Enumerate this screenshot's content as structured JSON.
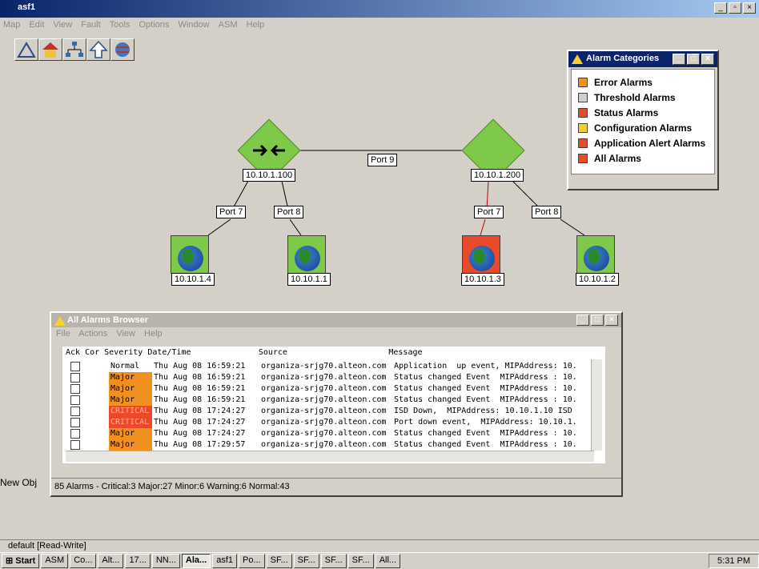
{
  "window": {
    "title": "asf1",
    "menu": [
      "Map",
      "Edit",
      "View",
      "Fault",
      "Tools",
      "Options",
      "Window",
      "ASM",
      "Help"
    ]
  },
  "map": {
    "switches": [
      {
        "ip": "10.10.1.100"
      },
      {
        "ip": "10.10.1.200"
      }
    ],
    "ports": {
      "trunk": "Port 9",
      "a7": "Port 7",
      "a8": "Port 8",
      "b7": "Port 7",
      "b8": "Port 8"
    },
    "hosts": [
      {
        "ip": "10.10.1.4",
        "status": "ok"
      },
      {
        "ip": "10.10.1.1",
        "status": "ok"
      },
      {
        "ip": "10.10.1.3",
        "status": "critical"
      },
      {
        "ip": "10.10.1.2",
        "status": "ok"
      }
    ]
  },
  "alarm_categories": {
    "title": "Alarm Categories",
    "items": [
      {
        "label": "Error Alarms",
        "color": "#f09020"
      },
      {
        "label": "Threshold Alarms",
        "color": "#d0d0d0"
      },
      {
        "label": "Status Alarms",
        "color": "#e84a2a"
      },
      {
        "label": "Configuration Alarms",
        "color": "#f8d030"
      },
      {
        "label": "Application Alert Alarms",
        "color": "#e84a2a"
      },
      {
        "label": "All Alarms",
        "color": "#e84a2a"
      }
    ]
  },
  "browser": {
    "title": "All Alarms Browser",
    "menu": [
      "File",
      "Actions",
      "View",
      "Help"
    ],
    "header": "Ack Cor Severity Date/Time              Source                     Message",
    "rows": [
      {
        "sev": "Normal",
        "cls": "normal",
        "dt": "Thu Aug 08 16:59:21",
        "src": "organiza-srjg70.alteon.com",
        "msg": "Application  up event, MIPAddress: 10."
      },
      {
        "sev": "Major",
        "cls": "major",
        "dt": "Thu Aug 08 16:59:21",
        "src": "organiza-srjg70.alteon.com",
        "msg": "Status changed Event  MIPAddress : 10."
      },
      {
        "sev": "Major",
        "cls": "major",
        "dt": "Thu Aug 08 16:59:21",
        "src": "organiza-srjg70.alteon.com",
        "msg": "Status changed Event  MIPAddress : 10."
      },
      {
        "sev": "Major",
        "cls": "major",
        "dt": "Thu Aug 08 16:59:21",
        "src": "organiza-srjg70.alteon.com",
        "msg": "Status changed Event  MIPAddress : 10."
      },
      {
        "sev": "CRITICAL",
        "cls": "critical",
        "dt": "Thu Aug 08 17:24:27",
        "src": "organiza-srjg70.alteon.com",
        "msg": "ISD Down,  MIPAddress: 10.10.1.10 ISD"
      },
      {
        "sev": "CRITICAL",
        "cls": "critical",
        "dt": "Thu Aug 08 17:24:27",
        "src": "organiza-srjg70.alteon.com",
        "msg": "Port down event,  MIPAddress: 10.10.1."
      },
      {
        "sev": "Major",
        "cls": "major",
        "dt": "Thu Aug 08 17:24:27",
        "src": "organiza-srjg70.alteon.com",
        "msg": "Status changed Event  MIPAddress : 10."
      },
      {
        "sev": "Major",
        "cls": "major",
        "dt": "Thu Aug 08 17:29:57",
        "src": "organiza-srjg70.alteon.com",
        "msg": "Status changed Event  MIPAddress : 10."
      }
    ],
    "summary": "85 Alarms - Critical:3 Major:27 Minor:6 Warning:6 Normal:43"
  },
  "new_obj": "New Obj",
  "status": "default [Read-Write]",
  "taskbar": {
    "start": "Start",
    "tasks": [
      "ASM",
      "Co...",
      "Alt...",
      "17...",
      "NN...",
      "Ala...",
      "asf1",
      "Po...",
      "SF...",
      "SF...",
      "SF...",
      "SF...",
      "All..."
    ],
    "active_index": 5,
    "clock": "5:31 PM"
  }
}
